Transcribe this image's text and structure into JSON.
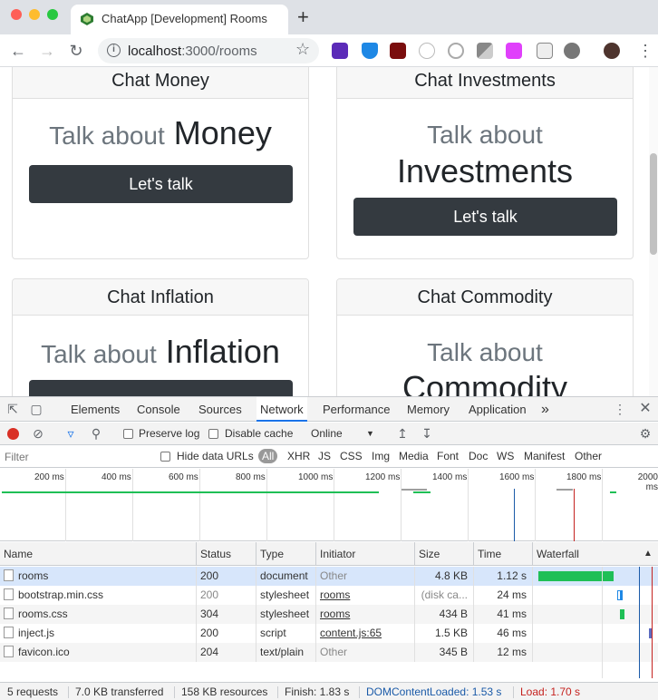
{
  "browser": {
    "tab_title": "ChatApp [Development] Rooms",
    "url_host": "localhost",
    "url_rest": ":3000/rooms"
  },
  "cards": [
    {
      "header": "Chat Money",
      "lead": "Talk about",
      "topic": "Money",
      "button": "Let's talk"
    },
    {
      "header": "Chat Investments",
      "lead": "Talk about",
      "topic": "Investments",
      "button": "Let's talk"
    },
    {
      "header": "Chat Inflation",
      "lead": "Talk about",
      "topic": "Inflation",
      "button": ""
    },
    {
      "header": "Chat Commodity",
      "lead": "Talk about",
      "topic": "Commodity",
      "button": ""
    }
  ],
  "devtools": {
    "tabs": [
      "Elements",
      "Console",
      "Sources",
      "Network",
      "Performance",
      "Memory",
      "Application"
    ],
    "more": "»",
    "preserve_log": "Preserve log",
    "disable_cache": "Disable cache",
    "throttle": "Online",
    "filter_placeholder": "Filter",
    "hide_data_urls": "Hide data URLs",
    "type_filters": [
      "All",
      "XHR",
      "JS",
      "CSS",
      "Img",
      "Media",
      "Font",
      "Doc",
      "WS",
      "Manifest",
      "Other"
    ],
    "overview_ticks": [
      "200 ms",
      "400 ms",
      "600 ms",
      "800 ms",
      "1000 ms",
      "1200 ms",
      "1400 ms",
      "1600 ms",
      "1800 ms",
      "2000 ms"
    ],
    "columns": [
      "Name",
      "Status",
      "Type",
      "Initiator",
      "Size",
      "Time",
      "Waterfall"
    ],
    "sort_indicator": "▲",
    "rows": [
      {
        "name": "rooms",
        "status": "200",
        "type": "document",
        "initiator": "Other",
        "size": "4.8 KB",
        "time": "1.12 s"
      },
      {
        "name": "bootstrap.min.css",
        "status": "200",
        "type": "stylesheet",
        "initiator": "rooms",
        "size": "(disk ca...",
        "time": "24 ms"
      },
      {
        "name": "rooms.css",
        "status": "304",
        "type": "stylesheet",
        "initiator": "rooms",
        "size": "434 B",
        "time": "41 ms"
      },
      {
        "name": "inject.js",
        "status": "200",
        "type": "script",
        "initiator": "content.js:65",
        "size": "1.5 KB",
        "time": "46 ms"
      },
      {
        "name": "favicon.ico",
        "status": "204",
        "type": "text/plain",
        "initiator": "Other",
        "size": "345 B",
        "time": "12 ms"
      }
    ],
    "status_bar": {
      "requests": "5 requests",
      "transferred": "7.0 KB transferred",
      "resources": "158 KB resources",
      "finish": "Finish: 1.83 s",
      "dom_content_loaded": "DOMContentLoaded: 1.53 s",
      "load": "Load: 1.70 s"
    }
  },
  "colors": {
    "dom_content_loaded": "#1a5aa8",
    "load": "#c5221f",
    "waterfall_green": "#1fbf56",
    "waterfall_blue": "#1e88e5"
  }
}
